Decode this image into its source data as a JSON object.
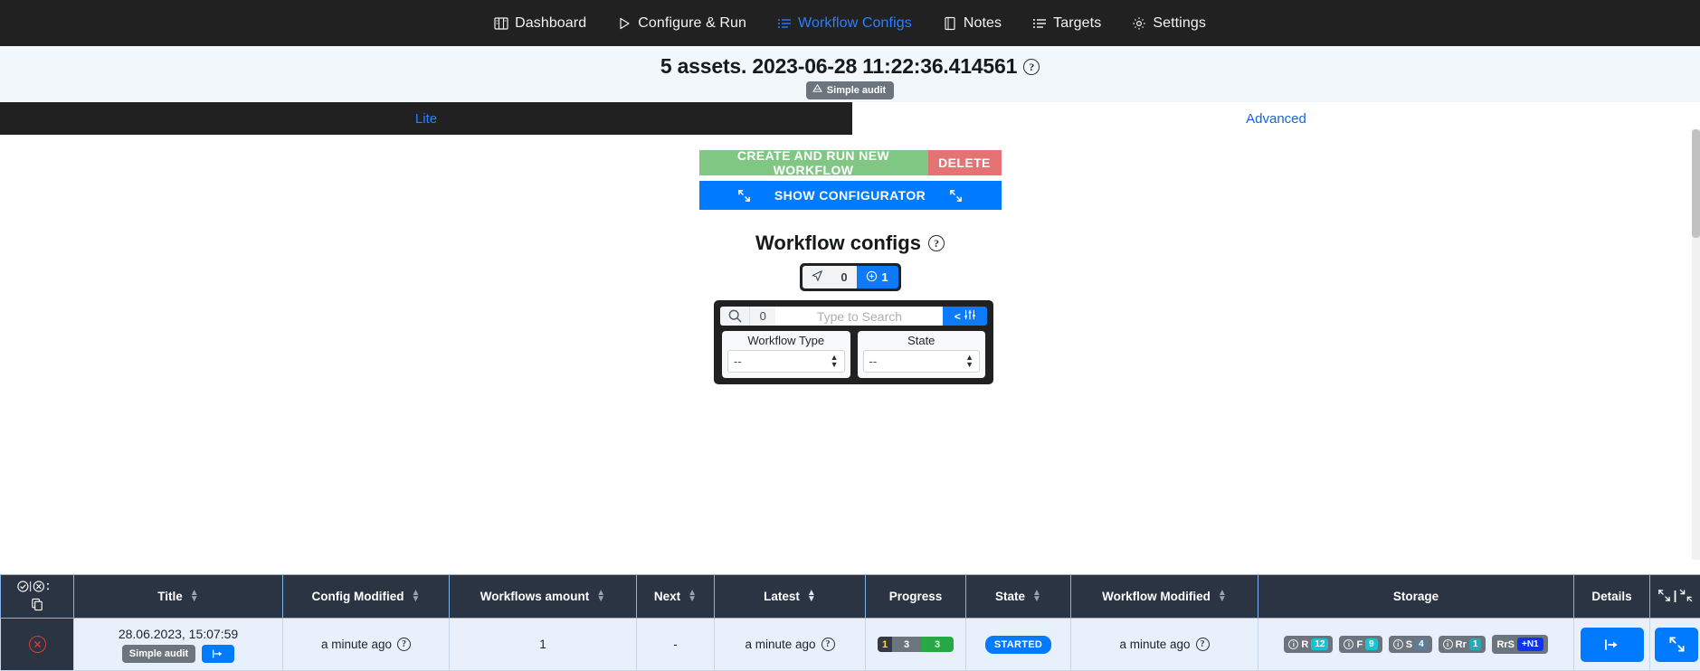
{
  "navbar": {
    "items": [
      {
        "label": "Dashboard",
        "icon": "dashboard-icon",
        "active": false
      },
      {
        "label": "Configure & Run",
        "icon": "play-triangle-icon",
        "active": false
      },
      {
        "label": "Workflow Configs",
        "icon": "list-icon",
        "active": true
      },
      {
        "label": "Notes",
        "icon": "notebook-icon",
        "active": false
      },
      {
        "label": "Targets",
        "icon": "list-icon",
        "active": false
      },
      {
        "label": "Settings",
        "icon": "gear-icon",
        "active": false
      }
    ],
    "active_color": "#2a7fff",
    "background": "#212121"
  },
  "header": {
    "title": "5 assets. 2023-06-28 11:22:36.414561",
    "help_icon": "?",
    "audit_badge": "Simple audit"
  },
  "tabs": [
    {
      "label": "Lite",
      "active": false
    },
    {
      "label": "Advanced",
      "active": true
    }
  ],
  "actions": {
    "create_label": "CREATE AND RUN NEW WORKFLOW",
    "delete_label": "DELETE",
    "configurator_label": "SHOW CONFIGURATOR"
  },
  "workflow_configs": {
    "heading": "Workflow configs",
    "help_icon": "?",
    "pills": [
      {
        "icon": "send-arrow-icon",
        "value": "0",
        "active": false
      },
      {
        "icon": "plus-circle-icon",
        "value": "1",
        "active": true
      }
    ]
  },
  "search": {
    "icon": "search-icon",
    "count": "0",
    "placeholder": "Type to Search",
    "value": "",
    "filter_button": "< ⦀",
    "filters": [
      {
        "label": "Workflow Type",
        "value": "--"
      },
      {
        "label": "State",
        "value": "--"
      }
    ]
  },
  "table": {
    "columns": [
      {
        "label": "",
        "sortable": true,
        "icons": "check-cancel-copy-icons"
      },
      {
        "label": "Title",
        "sortable": true
      },
      {
        "label": "Config Modified",
        "sortable": true
      },
      {
        "label": "Workflows amount",
        "sortable": true
      },
      {
        "label": "Next",
        "sortable": true
      },
      {
        "label": "Latest",
        "sortable": true
      },
      {
        "label": "Progress",
        "sortable": false
      },
      {
        "label": "State",
        "sortable": true
      },
      {
        "label": "Workflow Modified",
        "sortable": true
      },
      {
        "label": "Storage",
        "sortable": false
      },
      {
        "label": "Details",
        "sortable": false
      },
      {
        "label": "",
        "sortable": false,
        "icons": "expand-collapse-icons"
      }
    ],
    "rows": [
      {
        "delete_icon": "cancel-circle-icon",
        "title_date": "28.06.2023, 15:07:59",
        "title_audit_chip": "Simple audit",
        "title_run_icon": "run-icon",
        "config_modified": "a minute ago",
        "workflows_amount": "1",
        "next": "-",
        "latest": "a minute ago",
        "progress": {
          "segments": [
            {
              "value": "1",
              "kind": "pending"
            },
            {
              "value": "3",
              "kind": "running"
            },
            {
              "value": "3",
              "kind": "done"
            }
          ]
        },
        "state": "STARTED",
        "workflow_modified": "a minute ago",
        "storage": [
          {
            "label": "R",
            "value": "12",
            "color": "#17c4d4"
          },
          {
            "label": "F",
            "value": "9",
            "color": "#17c4d4"
          },
          {
            "label": "S",
            "value": "4",
            "color": "#5a7d99"
          },
          {
            "label": "Rr",
            "value": "1",
            "color": "#2aa9b5"
          },
          {
            "label": "RrS",
            "value": "+N1",
            "color": "#0d33f7"
          }
        ],
        "details_icon": "run-icon",
        "expand_icon": "expand-icon"
      }
    ]
  },
  "colors": {
    "accent_blue": "#007bff",
    "green": "#81c784",
    "red": "#e57373",
    "dark": "#212121",
    "table_header": "#2b3442",
    "row_bg": "#e8f1fb"
  }
}
